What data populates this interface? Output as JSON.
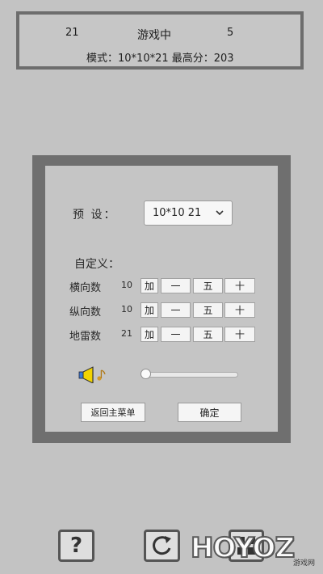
{
  "status": {
    "mines_left": "21",
    "game_state": "游戏中",
    "timer": "5",
    "mode_line": "模式：10*10*21   最高分：203"
  },
  "dialog": {
    "preset_label": "预  设：",
    "preset_value": "10*10  21",
    "custom_label": "自定义：",
    "rows": [
      {
        "label": "横向数",
        "value": "10"
      },
      {
        "label": "纵向数",
        "value": "10"
      },
      {
        "label": "地雷数",
        "value": "21"
      }
    ],
    "btn_add": "加",
    "btn_minus": "一",
    "btn_five": "五",
    "btn_plus": "十",
    "volume": 0,
    "back_button": "返回主菜单",
    "ok_button": "确定"
  },
  "toolbar": {
    "help_glyph": "?"
  },
  "watermark": {
    "text": "HOYOZ",
    "sub": "游戏网"
  }
}
